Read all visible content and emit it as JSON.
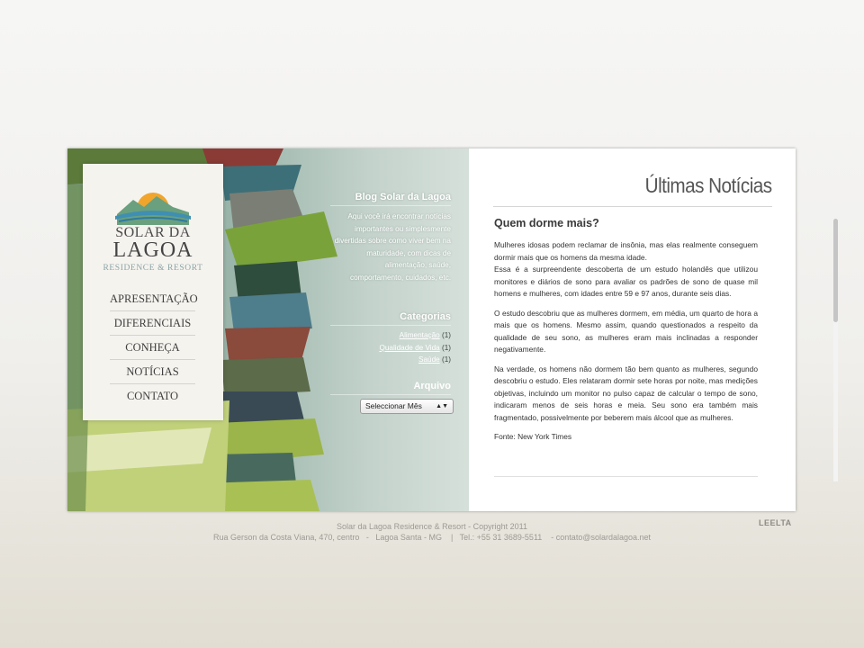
{
  "brand": {
    "line1": "SOLAR DA",
    "line2": "LAGOA",
    "line3": "RESIDENCE & RESORT",
    "colors": {
      "sun": "#f1a52b",
      "mountains": "#6aa07e",
      "water": "#3f8fb2"
    }
  },
  "nav": {
    "items": [
      {
        "label": "APRESENTAÇÃO"
      },
      {
        "label": "DIFERENCIAIS"
      },
      {
        "label": "CONHEÇA"
      },
      {
        "label": "NOTÍCIAS"
      },
      {
        "label": "CONTATO"
      }
    ]
  },
  "blog": {
    "title": "Blog Solar da Lagoa",
    "description": "Aqui você irá encontrar notícias importantes ou simplesmente divertidas sobre como viver bem na maturidade, com dicas de alimentação, saúde, comportamento, cuidados, etc."
  },
  "categories": {
    "title": "Categorias",
    "items": [
      {
        "label": "Alimentação",
        "count": "(1)"
      },
      {
        "label": "Qualidade de Vida",
        "count": "(1)"
      },
      {
        "label": "Saúde",
        "count": "(1)"
      }
    ]
  },
  "archive": {
    "title": "Arquivo",
    "select_value": "Seleccionar Mês"
  },
  "main": {
    "page_title": "Últimas Notícias",
    "article": {
      "title": "Quem dorme mais?",
      "p1": "Mulheres idosas podem reclamar de insônia, mas elas realmente conseguem dormir mais que os homens da mesma idade.",
      "p2": "Essa é a surpreendente descoberta de um estudo holandês que utilizou monitores e diários de sono para avaliar os padrões de sono de quase mil homens e mulheres, com idades entre 59 e 97 anos, durante seis dias.",
      "p3": "O estudo descobriu que as mulheres dormem, em média, um quarto de hora a mais que os homens. Mesmo assim, quando questionados a respeito da qualidade de seu sono, as mulheres eram mais inclinadas a responder negativamente.",
      "p4": "Na verdade, os homens não dormem tão bem quanto as mulheres, segundo descobriu o estudo. Eles relataram dormir sete horas por noite, mas medições objetivas, incluindo um monitor no pulso capaz de calcular o tempo de sono, indicaram menos de seis horas e meia. Seu sono era também mais fragmentado, possivelmente por beberem mais álcool que as mulheres.",
      "source": "Fonte: New York Times"
    }
  },
  "footer": {
    "copyright": "Solar da Lagoa Residence & Resort - Copyright 2011",
    "address": "Rua Gerson da Costa Viana, 470, centro   -   Lagoa Santa - MG    |   Tel.: +55 31 3689-5511    -",
    "email": "contato@solardalagoa.net",
    "credit": "LEELTA"
  }
}
